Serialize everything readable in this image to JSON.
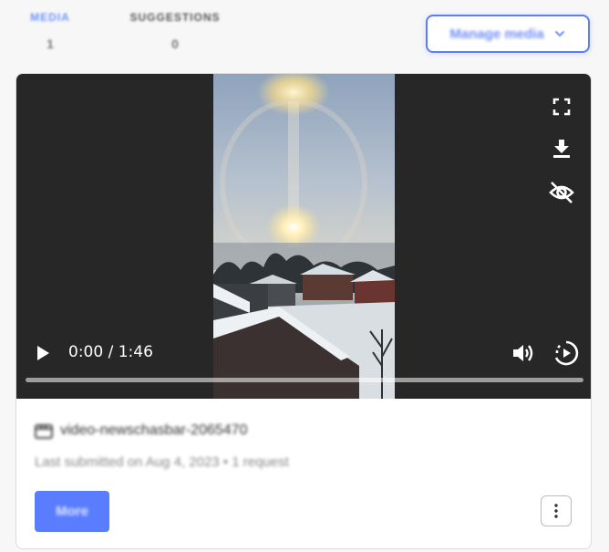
{
  "tabs": [
    {
      "label": "MEDIA",
      "count": "1"
    },
    {
      "label": "SUGGESTIONS",
      "count": "0"
    }
  ],
  "manage_button": {
    "label": "Manage media",
    "icon": "chevron-down-icon"
  },
  "video": {
    "time_display": "0:00 / 1:46",
    "progress": 0,
    "icons": [
      "fullscreen-icon",
      "download-icon",
      "hide-icon",
      "play-icon",
      "volume-icon",
      "playback-speed-icon"
    ]
  },
  "item": {
    "icon": "video-icon",
    "title": "video-newschasbar-2065470",
    "subtitle": "Last submitted on Aug 4, 2023 • 1 request"
  },
  "more_button": {
    "label": "More"
  },
  "colors": {
    "accent": "#5a7dff",
    "video_bg": "#272727"
  }
}
